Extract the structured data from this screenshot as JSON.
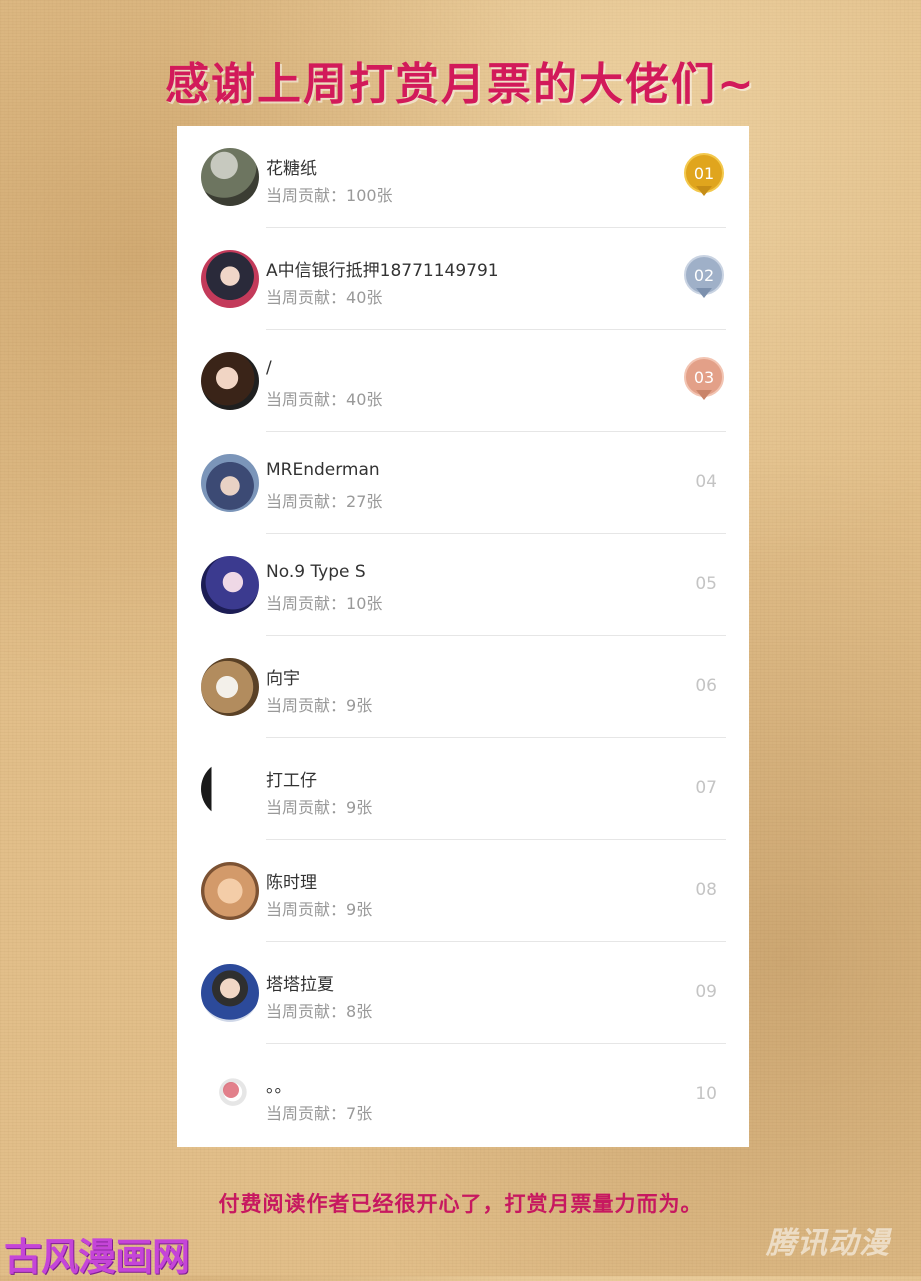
{
  "title": "感谢上周打赏月票的大佬们~",
  "contribution_label": "当周贡献：",
  "entries": [
    {
      "rank": "01",
      "name": "花糖纸",
      "contribution": "100张",
      "medal": "gold"
    },
    {
      "rank": "02",
      "name": "A中信银行抵押18771149791",
      "contribution": "40张",
      "medal": "silver"
    },
    {
      "rank": "03",
      "name": "/",
      "contribution": "40张",
      "medal": "bronze"
    },
    {
      "rank": "04",
      "name": "MREnderman",
      "contribution": "27张",
      "medal": ""
    },
    {
      "rank": "05",
      "name": "No.9 Type S",
      "contribution": "10张",
      "medal": ""
    },
    {
      "rank": "06",
      "name": "向宇",
      "contribution": "9张",
      "medal": ""
    },
    {
      "rank": "07",
      "name": "打工仔",
      "contribution": "9张",
      "medal": ""
    },
    {
      "rank": "08",
      "name": "陈时理",
      "contribution": "9张",
      "medal": ""
    },
    {
      "rank": "09",
      "name": "塔塔拉夏",
      "contribution": "8张",
      "medal": ""
    },
    {
      "rank": "10",
      "name": "。。",
      "contribution": "7张",
      "medal": ""
    }
  ],
  "medal_colors": {
    "gold": {
      "fill": "#e0a51d",
      "ring": "#f3c84c",
      "ribbon": "#c68d16"
    },
    "silver": {
      "fill": "#9fb0c8",
      "ring": "#c9d3e2",
      "ribbon": "#7c90ad"
    },
    "bronze": {
      "fill": "#e3a088",
      "ring": "#f2c4b2",
      "ribbon": "#c98469"
    }
  },
  "footer": "付费阅读作者已经很开心了，打赏月票量力而为。",
  "watermark_left": "古风漫画网",
  "watermark_right": "腾讯动漫"
}
